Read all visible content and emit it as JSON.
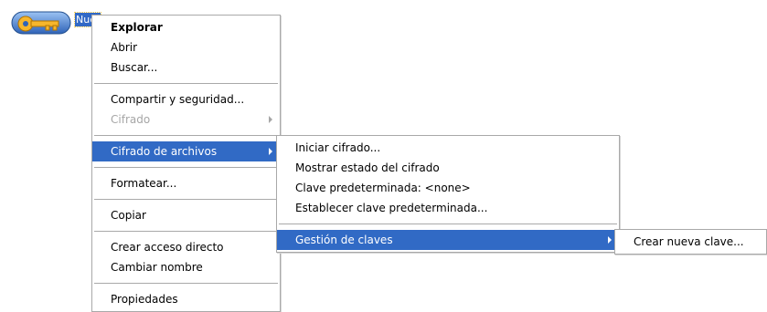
{
  "desktop": {
    "icon_name": "key-folder-icon",
    "label": "Nueva carpeta"
  },
  "context_menu": {
    "items": [
      {
        "label": "Explorar"
      },
      {
        "label": "Abrir"
      },
      {
        "label": "Buscar..."
      },
      {
        "label": "Compartir y seguridad..."
      },
      {
        "label": "Cifrado"
      },
      {
        "label": "Cifrado de archivos"
      },
      {
        "label": "Formatear..."
      },
      {
        "label": "Copiar"
      },
      {
        "label": "Crear acceso directo"
      },
      {
        "label": "Cambiar nombre"
      },
      {
        "label": "Propiedades"
      }
    ]
  },
  "encryption_submenu": {
    "items": [
      {
        "label": "Iniciar cifrado..."
      },
      {
        "label": "Mostrar estado del cifrado"
      },
      {
        "label": "Clave predeterminada: <none>"
      },
      {
        "label": "Establecer clave predeterminada..."
      },
      {
        "label": "Gestión de claves"
      }
    ]
  },
  "key_submenu": {
    "items": [
      {
        "label": "Crear nueva clave..."
      }
    ]
  },
  "colors": {
    "highlight": "#316ac5",
    "menu_border": "#a9a9a9",
    "disabled_text": "#a6a6a6",
    "icon_blue": "#3f78d4",
    "key_orange": "#f0a020"
  }
}
